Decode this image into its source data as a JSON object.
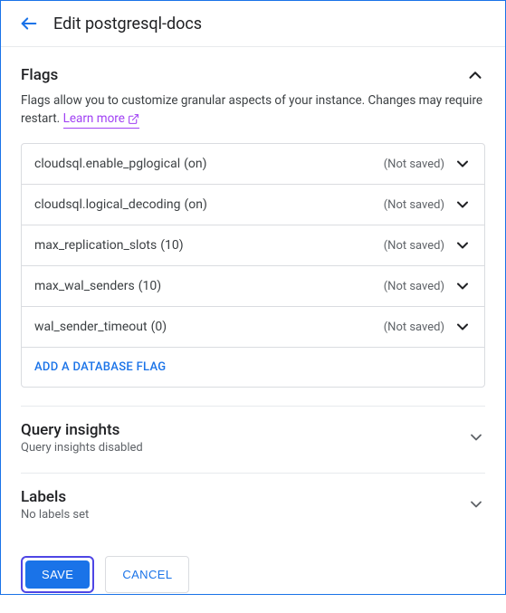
{
  "header": {
    "title": "Edit postgresql-docs"
  },
  "flags_section": {
    "title": "Flags",
    "description": "Flags allow you to customize granular aspects of your instance. Changes may require restart.",
    "learn_more": "Learn more",
    "add_label": "ADD A DATABASE FLAG",
    "status_label": "(Not saved)",
    "items": [
      {
        "name": "cloudsql.enable_pglogical",
        "value": "(on)"
      },
      {
        "name": "cloudsql.logical_decoding",
        "value": "(on)"
      },
      {
        "name": "max_replication_slots",
        "value": "(10)"
      },
      {
        "name": "max_wal_senders",
        "value": "(10)"
      },
      {
        "name": "wal_sender_timeout",
        "value": "(0)"
      }
    ]
  },
  "query_insights": {
    "title": "Query insights",
    "subtitle": "Query insights disabled"
  },
  "labels": {
    "title": "Labels",
    "subtitle": "No labels set"
  },
  "footer": {
    "save": "SAVE",
    "cancel": "CANCEL"
  }
}
